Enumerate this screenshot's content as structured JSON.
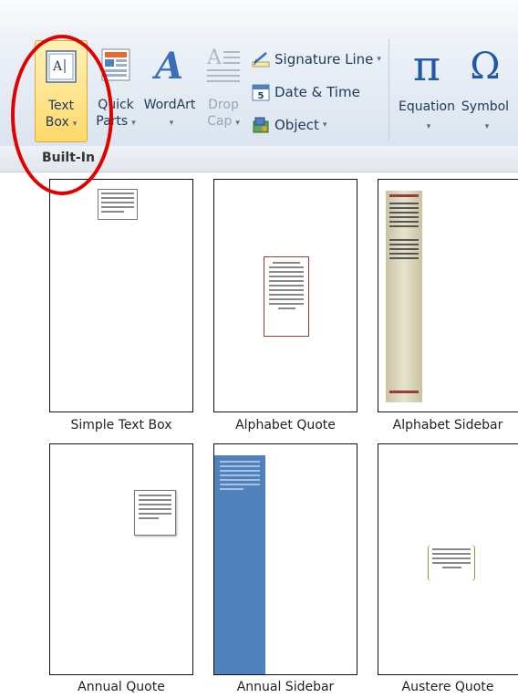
{
  "ribbon": {
    "text_box": {
      "label1": "Text",
      "label2": "Box",
      "arrow": "▾"
    },
    "quick_parts": {
      "label1": "Quick",
      "label2": "Parts",
      "arrow": "▾"
    },
    "wordart": {
      "label1": "WordArt",
      "arrow": "▾"
    },
    "drop_cap": {
      "label1": "Drop",
      "label2": "Cap",
      "arrow": "▾"
    },
    "signature_line": {
      "label": "Signature Line",
      "arrow": "▾"
    },
    "date_time": {
      "label": "Date & Time",
      "icon_text": "5"
    },
    "object": {
      "label": "Object",
      "arrow": "▾"
    },
    "equation": {
      "label": "Equation",
      "glyph": "π",
      "arrow": "▾"
    },
    "symbol": {
      "label": "Symbol",
      "glyph": "Ω",
      "arrow": "▾"
    }
  },
  "gallery": {
    "section_title": "Built-In",
    "items": [
      {
        "label": "Simple Text Box"
      },
      {
        "label": "Alphabet Quote"
      },
      {
        "label": "Alphabet Sidebar"
      },
      {
        "label": "Annual Quote"
      },
      {
        "label": "Annual Sidebar"
      },
      {
        "label": "Austere Quote"
      }
    ]
  },
  "colors": {
    "highlight": "#ffd96a",
    "annotation": "#e00000",
    "annual_sidebar": "#4f81bd",
    "alphabet_sidebar": "#ddd9c3"
  }
}
